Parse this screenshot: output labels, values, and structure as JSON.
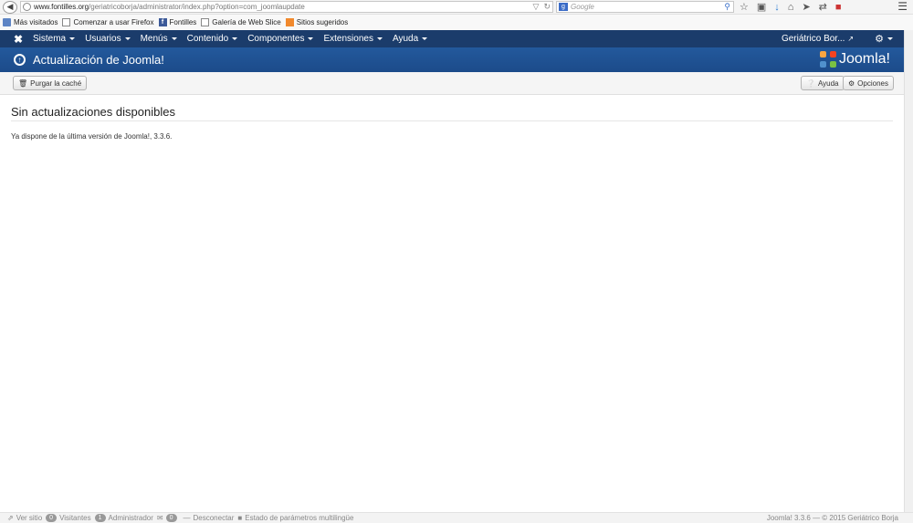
{
  "browser": {
    "url_domain": "www.fontilles.org",
    "url_path": "/geriatricoborja/administrator/index.php?option=com_joomlaupdate",
    "search_placeholder": "Google"
  },
  "bookmarks": [
    {
      "label": "Más visitados",
      "icon": "folder-icon"
    },
    {
      "label": "Comenzar a usar Firefox",
      "icon": "page-icon"
    },
    {
      "label": "Fontilles",
      "icon": "facebook-icon"
    },
    {
      "label": "Galería de Web Slice",
      "icon": "page-icon"
    },
    {
      "label": "Sitios sugeridos",
      "icon": "web-slice-icon"
    }
  ],
  "nav": {
    "items": [
      "Sistema",
      "Usuarios",
      "Menús",
      "Contenido",
      "Componentes",
      "Extensiones",
      "Ayuda"
    ],
    "site_name": "Geriátrico Bor..."
  },
  "header": {
    "title": "Actualización de Joomla!",
    "logo_text": "Joomla!"
  },
  "toolbar": {
    "purge_label": "Purgar la caché",
    "help_label": "Ayuda",
    "options_label": "Opciones"
  },
  "main": {
    "heading": "Sin actualizaciones disponibles",
    "message": "Ya dispone de la última versión de Joomla!, 3.3.6."
  },
  "status": {
    "view_site": "Ver sitio",
    "visitors_count": "0",
    "visitors_label": "Visitantes",
    "admins_count": "1",
    "admins_label": "Administrador",
    "messages_count": "0",
    "logout": "Desconectar",
    "multilang": "Estado de parámetros multilingüe",
    "footer": "Joomla! 3.3.6 — © 2015 Geriátrico Borja"
  },
  "colors": {
    "navbar": "#1b3c6b",
    "titlebar": "#1f5394"
  }
}
